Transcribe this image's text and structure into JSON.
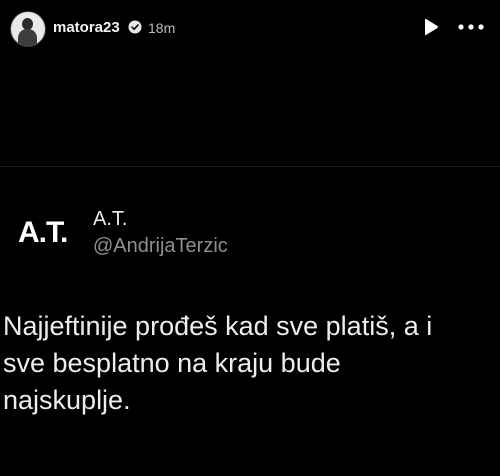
{
  "story": {
    "username": "matora23",
    "time_ago": "18m",
    "icons": {
      "avatar": "profile-avatar",
      "verified": "verified-badge-icon",
      "play": "play-icon",
      "more": "more-options-icon"
    }
  },
  "tweet": {
    "logo_text": "A.T.",
    "display_name": "A.T.",
    "handle": "@AndrijaTerzic",
    "text_lines": [
      "Najjeftinije prođeš kad sve platiš, a i",
      "sve besplatno na kraju bude",
      "najskuplje."
    ]
  },
  "colors": {
    "background": "#000000",
    "text": "#ededed",
    "muted": "#8f8f8f"
  }
}
